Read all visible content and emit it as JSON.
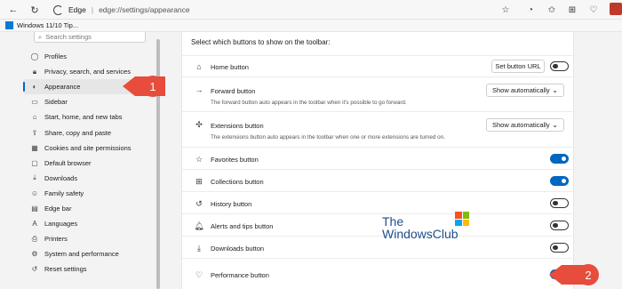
{
  "browser": {
    "site_name": "Edge",
    "separator": "|",
    "url": "edge://settings/appearance",
    "favorite": "Windows 11/10 Tip..."
  },
  "sidebar": {
    "search_placeholder": "Search settings",
    "items": [
      {
        "label": "Profiles",
        "icon": "profile-icon"
      },
      {
        "label": "Privacy, search, and services",
        "icon": "lock-icon"
      },
      {
        "label": "Appearance",
        "icon": "appearance-icon"
      },
      {
        "label": "Sidebar",
        "icon": "sidebar-icon"
      },
      {
        "label": "Start, home, and new tabs",
        "icon": "home-icon"
      },
      {
        "label": "Share, copy and paste",
        "icon": "share-icon"
      },
      {
        "label": "Cookies and site permissions",
        "icon": "cookie-icon"
      },
      {
        "label": "Default browser",
        "icon": "browser-icon"
      },
      {
        "label": "Downloads",
        "icon": "download-icon"
      },
      {
        "label": "Family safety",
        "icon": "family-icon"
      },
      {
        "label": "Edge bar",
        "icon": "edge-bar-icon"
      },
      {
        "label": "Languages",
        "icon": "language-icon"
      },
      {
        "label": "Printers",
        "icon": "printer-icon"
      },
      {
        "label": "System and performance",
        "icon": "system-icon"
      },
      {
        "label": "Reset settings",
        "icon": "reset-icon"
      }
    ],
    "active_index": 2
  },
  "main": {
    "section_title": "Select which buttons to show on the toolbar:",
    "rows": {
      "home": {
        "label": "Home button",
        "button": "Set button URL",
        "toggle": false
      },
      "forward": {
        "label": "Forward button",
        "desc": "The forward button auto appears in the toolbar when it's possible to go forward.",
        "select": "Show automatically"
      },
      "extensions": {
        "label": "Extensions button",
        "desc": "The extensions button auto appears in the toolbar when one or more extensions are turned on.",
        "select": "Show automatically"
      },
      "favorites": {
        "label": "Favorites button",
        "toggle": true
      },
      "collections": {
        "label": "Collections button",
        "toggle": true
      },
      "history": {
        "label": "History button",
        "toggle": false
      },
      "alerts": {
        "label": "Alerts and tips button",
        "toggle": false
      },
      "downloads": {
        "label": "Downloads button",
        "toggle": false
      },
      "performance": {
        "label": "Performance button",
        "toggle": true
      }
    }
  },
  "annotations": {
    "callout1": "1",
    "callout2": "2",
    "color": "#e74c3c"
  },
  "watermark": {
    "line1": "The",
    "line2": "WindowsClub"
  }
}
